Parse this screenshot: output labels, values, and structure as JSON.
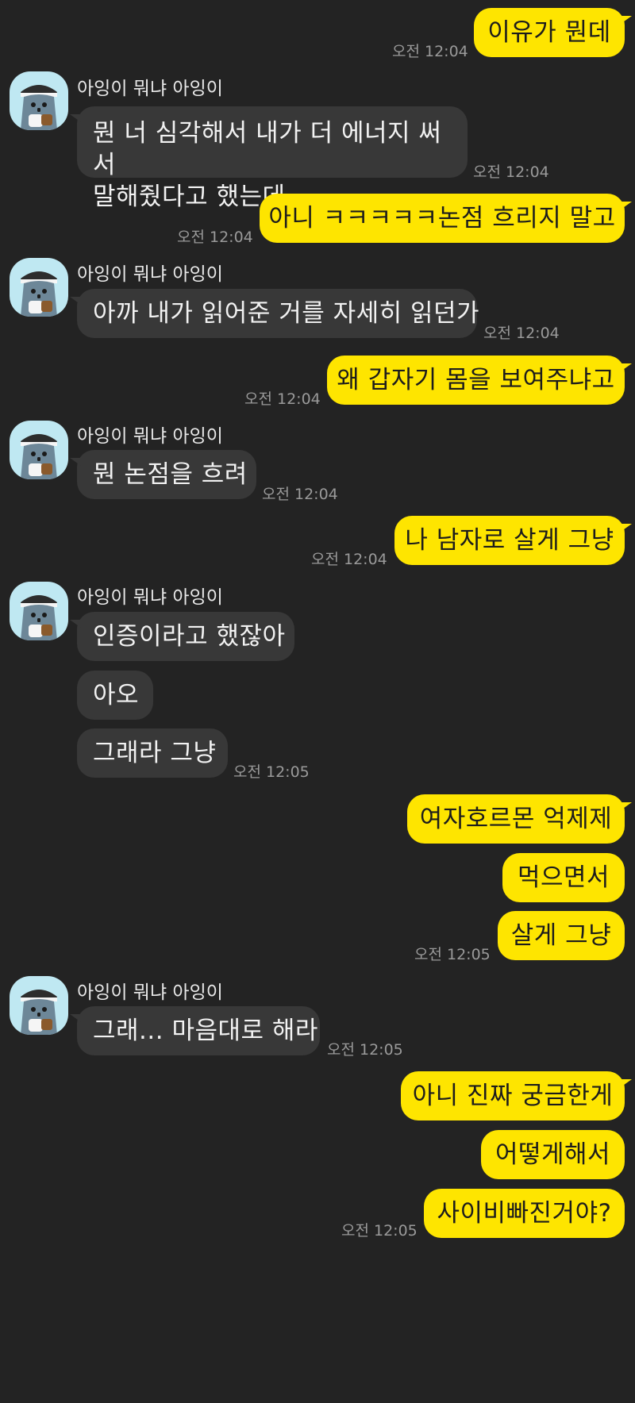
{
  "sender_name": "아잉이 뭐냐 아잉이",
  "messages": {
    "m1": {
      "text": "이유가 뭔데",
      "time": "오전 12:04"
    },
    "m2": {
      "line1": "뭔 너 심각해서 내가 더 에너지 써서",
      "line2": "말해줬다고 했는데",
      "time": "오전 12:04"
    },
    "m3": {
      "text": "아니 ㅋㅋㅋㅋㅋ논점 흐리지 말고",
      "time": "오전 12:04"
    },
    "m4": {
      "text": "아까 내가 읽어준 거를 자세히 읽던가",
      "time": "오전 12:04"
    },
    "m5": {
      "text": "왜 갑자기 몸을 보여주냐고",
      "time": "오전 12:04"
    },
    "m6": {
      "text": "뭔 논점을 흐려",
      "time": "오전 12:04"
    },
    "m7": {
      "text": "나 남자로 살게 그냥",
      "time": "오전 12:04"
    },
    "m8": {
      "text": "인증이라고 했잖아"
    },
    "m9": {
      "text": "아오"
    },
    "m10": {
      "text": "그래라 그냥",
      "time": "오전 12:05"
    },
    "m11": {
      "text": "여자호르몬 억제제"
    },
    "m12": {
      "text": "먹으면서"
    },
    "m13": {
      "text": "살게 그냥",
      "time": "오전 12:05"
    },
    "m14": {
      "text": "그래... 마음대로 해라",
      "time": "오전 12:05"
    },
    "m15": {
      "text": "아니 진짜 궁금한게"
    },
    "m16": {
      "text": "어떻게해서"
    },
    "m17": {
      "text": "사이비빠진거야?",
      "time": "오전 12:05"
    }
  },
  "colors": {
    "background": "#232323",
    "my_bubble": "#fee500",
    "their_bubble": "#383838",
    "timestamp": "#9a9a9a",
    "avatar_bg": "#bfe8f2"
  },
  "icons": {
    "avatar": "cat-character-avatar-icon"
  }
}
